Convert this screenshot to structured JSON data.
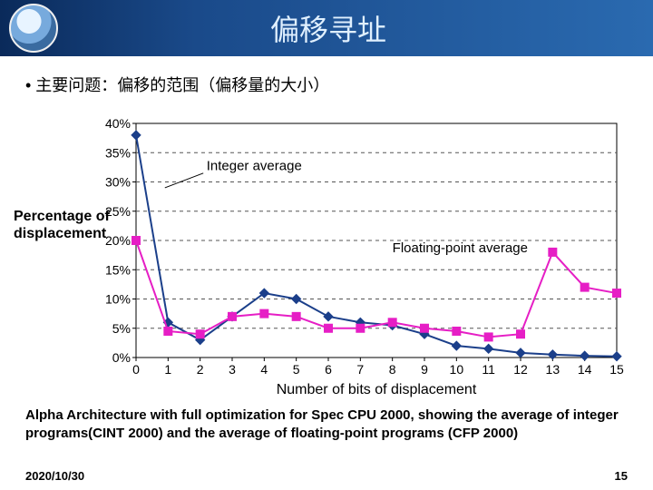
{
  "header": {
    "title": "偏移寻址"
  },
  "bullet": "•   主要问题：偏移的范围（偏移量的大小）",
  "ylabel_line1": "Percentage of",
  "ylabel_line2": "displacement",
  "series_labels": {
    "integer": "Integer average",
    "float": "Floating-point average"
  },
  "caption": "Alpha Architecture with full optimization for Spec CPU 2000, showing the average of integer programs(CINT 2000) and the average of floating-point programs (CFP 2000)",
  "footer": {
    "date": "2020/10/30",
    "page": "15"
  },
  "chart_data": {
    "type": "line",
    "xlabel": "Number of bits of displacement",
    "ylabel": "Percentage of displacement",
    "x": [
      0,
      1,
      2,
      3,
      4,
      5,
      6,
      7,
      8,
      9,
      10,
      11,
      12,
      13,
      14,
      15
    ],
    "yticks": [
      0,
      5,
      10,
      15,
      20,
      25,
      30,
      35,
      40
    ],
    "ytick_labels": [
      "0%",
      "5%",
      "10%",
      "15%",
      "20%",
      "25%",
      "30%",
      "35%",
      "40%"
    ],
    "series": [
      {
        "name": "Integer average",
        "color": "#1b3f8a",
        "marker": "diamond",
        "values": [
          38,
          6,
          3,
          7,
          11,
          10,
          7,
          6,
          5.5,
          4,
          2,
          1.5,
          0.8,
          0.5,
          0.3,
          0.2
        ]
      },
      {
        "name": "Floating-point average",
        "color": "#e61ec5",
        "marker": "square",
        "values": [
          20,
          4.5,
          4,
          7,
          7.5,
          7,
          5,
          5,
          6,
          5,
          4.5,
          3.5,
          4,
          18,
          12,
          11
        ]
      }
    ],
    "ylim": [
      0,
      40
    ],
    "grid": "horizontal-dashed"
  }
}
